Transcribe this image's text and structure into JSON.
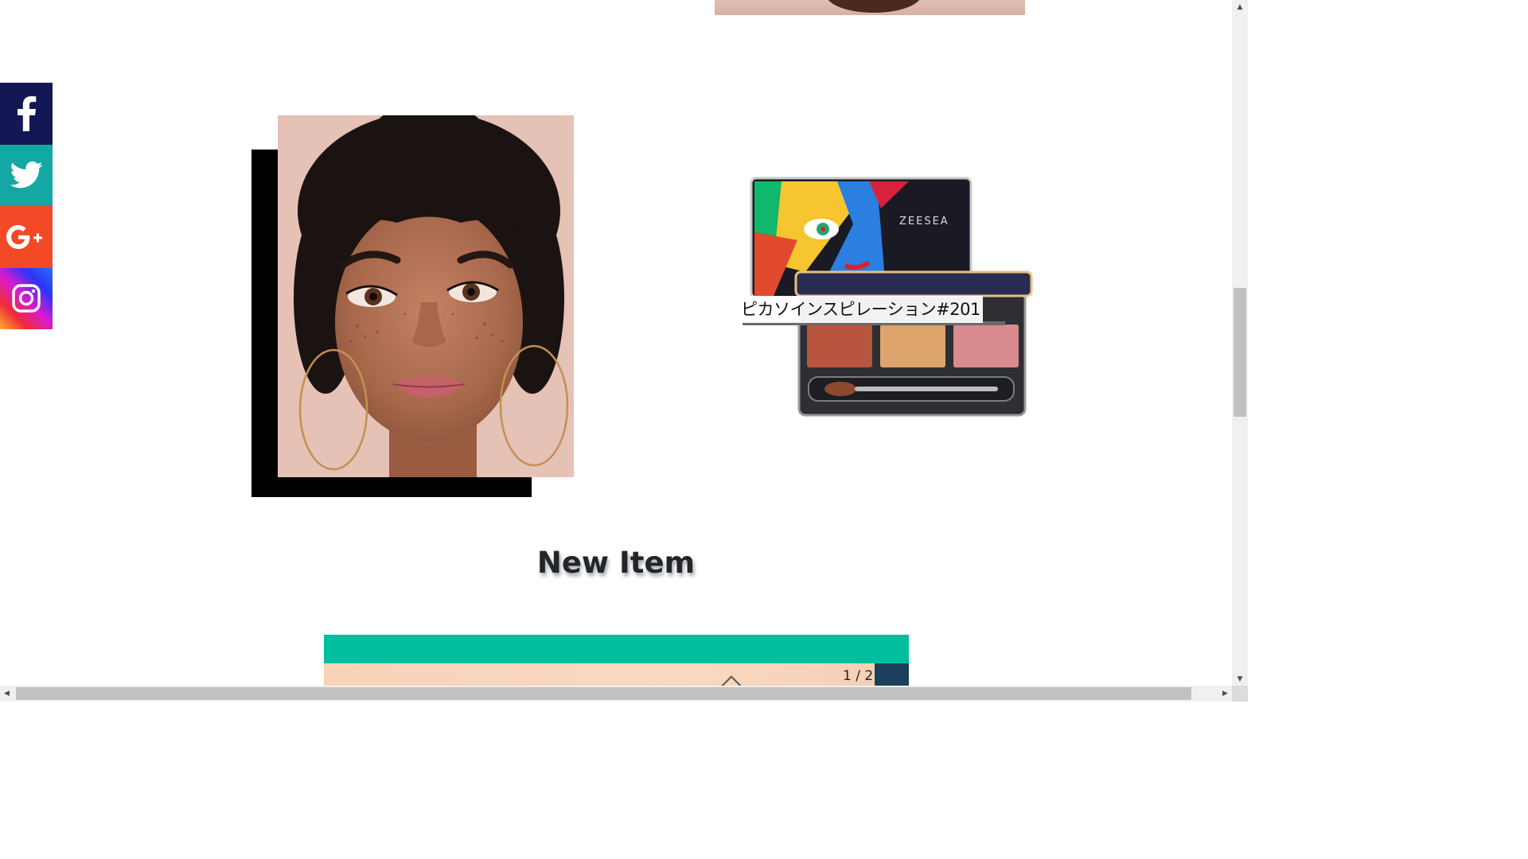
{
  "social": {
    "items": [
      {
        "label": "Facebook",
        "icon": "facebook-icon",
        "color": "#131754"
      },
      {
        "label": "Twitter",
        "icon": "twitter-icon",
        "color": "#13a8a4"
      },
      {
        "label": "Google+",
        "icon": "google-plus-icon",
        "color": "#f24a26"
      },
      {
        "label": "Instagram",
        "icon": "instagram-icon",
        "color": "#d51ad4"
      }
    ]
  },
  "product": {
    "label": "ピカソインスピレーション#201",
    "brand": "ZEESEA"
  },
  "section": {
    "title": "New Item"
  },
  "carousel": {
    "counter": "1 / 2",
    "accent_color": "#00bf9e"
  },
  "scrollbars": {
    "up_arrow": "▲",
    "down_arrow": "▼",
    "left_arrow": "◀",
    "right_arrow": "▶"
  }
}
